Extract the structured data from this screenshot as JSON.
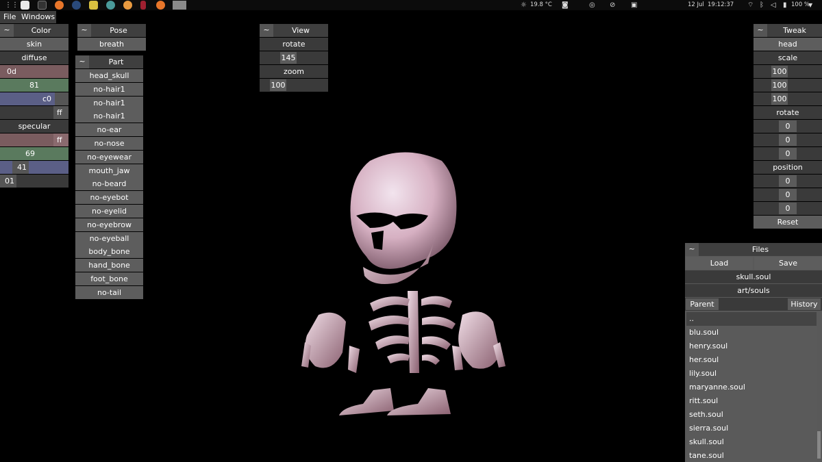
{
  "topbar": {
    "weather": "19.8 °C",
    "date": "12 Jul",
    "time": "19:12:37",
    "battery": "100 %"
  },
  "menu": {
    "file": "File",
    "windows": "Windows"
  },
  "color_panel": {
    "title": "Color",
    "toggle": "~",
    "material": "skin",
    "diffuse_label": "diffuse",
    "diffuse": [
      "0d",
      "81",
      "c0",
      "ff"
    ],
    "specular_label": "specular",
    "specular": [
      "ff",
      "69",
      "41",
      "01"
    ]
  },
  "pose_panel": {
    "title": "Pose",
    "toggle": "~",
    "value": "breath"
  },
  "part_panel": {
    "title": "Part",
    "toggle": "~",
    "items": [
      "head_skull",
      "no-hair1",
      "no-hair1",
      "no-hair1",
      "no-ear",
      "no-nose",
      "no-eyewear",
      "mouth_jaw",
      "no-beard",
      "no-eyebot",
      "no-eyelid",
      "no-eyebrow",
      "no-eyeball",
      "body_bone",
      "hand_bone",
      "foot_bone",
      "no-tail"
    ]
  },
  "view_panel": {
    "title": "View",
    "toggle": "~",
    "rotate_label": "rotate",
    "rotate": "145",
    "zoom_label": "zoom",
    "zoom": "100"
  },
  "tweak_panel": {
    "title": "Tweak",
    "toggle": "~",
    "part": "head",
    "scale_label": "scale",
    "scale": [
      "100",
      "100",
      "100"
    ],
    "rotate_label": "rotate",
    "rotate": [
      "0",
      "0",
      "0"
    ],
    "position_label": "position",
    "position": [
      "0",
      "0",
      "0"
    ],
    "reset": "Reset"
  },
  "files_panel": {
    "title": "Files",
    "toggle": "~",
    "load": "Load",
    "save": "Save",
    "filename": "skull.soul",
    "directory": "art/souls",
    "parent": "Parent",
    "history": "History",
    "files": [
      "..",
      "blu.soul",
      "henry.soul",
      "her.soul",
      "lily.soul",
      "maryanne.soul",
      "ritt.soul",
      "seth.soul",
      "sierra.soul",
      "skull.soul",
      "tane.soul"
    ]
  },
  "colors": {
    "panel_bg": "#575757",
    "title_bg": "#3f3f3f",
    "red_bar": "#7a5c5f",
    "green_bar": "#5a7a5e",
    "blue_bar": "#5b5f86",
    "bone": "#e6cdd8"
  }
}
